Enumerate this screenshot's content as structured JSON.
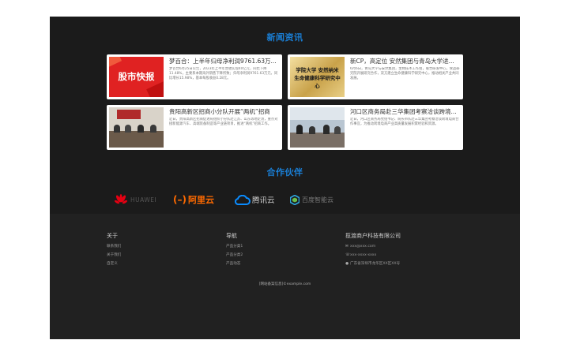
{
  "news": {
    "title": "新闻资讯",
    "items": [
      {
        "title": "梦百合：上半年归母净利润9761.63万...",
        "desc": "梦百合6月25日公告，2023年上半年营收实现40亿元，同比下降11.48%，主要系本期海外销售下降所致；归母净利润9761.63万元，同比增长15.98%，基本每股收益0.28元。",
        "thumb_text": "股市快报",
        "thumb_type": "red-banner"
      },
      {
        "title": "新CP，高定位 安然集团与青岛大学进...",
        "desc": "6月6日，青岛大学与安然集团，生物技术工作组，联合研发中心，食品研究院开展研究合作，双方建立生命健康科学研究中心，推动相关产业共同发展。",
        "thumb_text": "学院大学 安然纳米 生命健康科学研究中心",
        "thumb_type": "gold-plaque"
      },
      {
        "title": "贵阳高新区招商小分队开展“两机”招商",
        "desc": "近日，贵阳高新区招商促进局组织小分队赴江苏、山东等地走访，重点对接新能源汽车、高端装备制造等产业链项目，推进“两机”招商工作。",
        "thumb_text": "",
        "thumb_type": "meeting"
      },
      {
        "title": "河口区商务局赴三华集团考察洽谈跨境...",
        "desc": "近日，河口区商务局党组书记、局长带队赴三华集团考察洽谈跨境电商合作事宜，为推动跨境电商产业高质量发展积累经验和资源。",
        "thumb_text": "",
        "thumb_type": "meeting"
      }
    ]
  },
  "partners": {
    "title": "合作伙伴",
    "logos": [
      {
        "name": "HUAWEI",
        "icon": "huawei-flower-icon",
        "color": "#e60012"
      },
      {
        "name": "阿里云",
        "icon": "aliyun-bracket-icon",
        "color": "#ff6a00"
      },
      {
        "name": "腾讯云",
        "icon": "tencent-cloud-icon",
        "color": "#006eff"
      },
      {
        "name": "百度智能云",
        "icon": "baidu-cloud-icon",
        "color": "#2932e1"
      }
    ]
  },
  "footer": {
    "about": {
      "title": "关于",
      "links": [
        "联系我们",
        "关于我们",
        "自定义"
      ]
    },
    "nav": {
      "title": "导航",
      "links": [
        "产品分类1",
        "产品分类2",
        "产品动态"
      ]
    },
    "company": {
      "title": "揽渡商户科技有限公司",
      "email": "xxx@xxx.com",
      "phone": "xxx-xxxx-xxxx",
      "address": "广东省深圳市龙华区XX区XX号"
    },
    "copyright": "[网站备案信息]©example.com"
  }
}
